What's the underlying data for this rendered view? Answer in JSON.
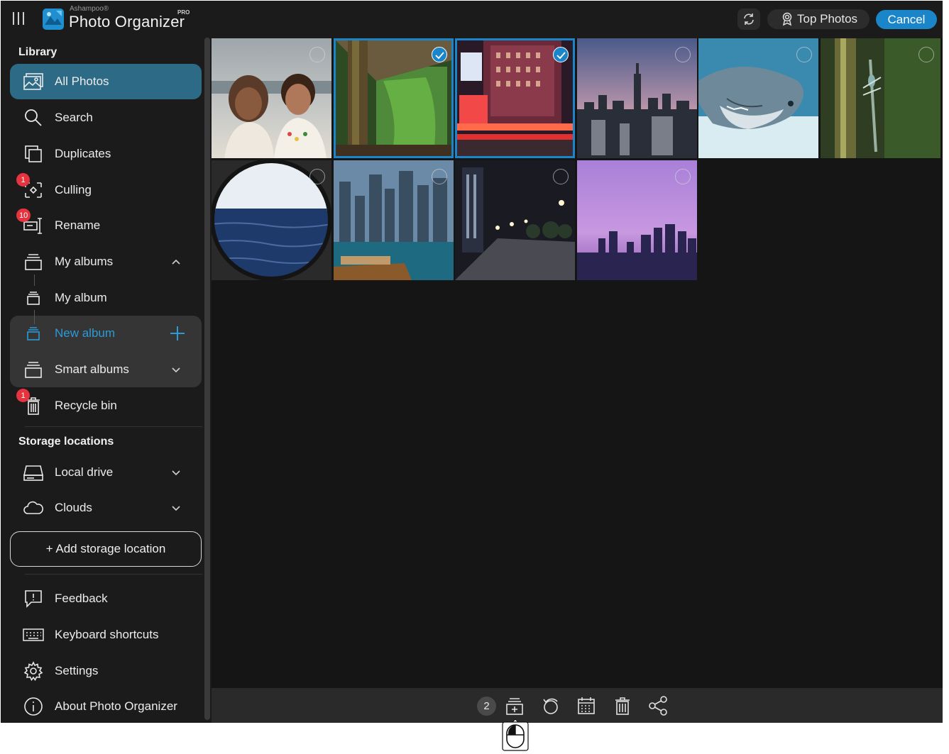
{
  "header": {
    "brand_small": "Ashampoo®",
    "brand_title": "Photo Organizer",
    "brand_badge": "PRO",
    "top_photos_label": "Top Photos",
    "cancel_label": "Cancel"
  },
  "sidebar": {
    "library_heading": "Library",
    "items": {
      "all_photos": "All Photos",
      "search": "Search",
      "duplicates": "Duplicates",
      "culling": "Culling",
      "rename": "Rename",
      "my_albums": "My albums",
      "my_album": "My album",
      "new_album": "New album",
      "smart_albums": "Smart albums",
      "recycle_bin": "Recycle bin",
      "local_drive": "Local drive",
      "clouds": "Clouds",
      "feedback": "Feedback",
      "keyboard_shortcuts": "Keyboard shortcuts",
      "settings": "Settings",
      "about": "About Photo Organizer"
    },
    "badges": {
      "culling": "1",
      "rename": "10",
      "recycle_bin": "1"
    },
    "storage_heading": "Storage locations",
    "add_storage_label": "+ Add storage location"
  },
  "grid": {
    "photos": [
      {
        "subject": "couple on beach",
        "selected": false
      },
      {
        "subject": "forest trees",
        "selected": true
      },
      {
        "subject": "times square night",
        "selected": true
      },
      {
        "subject": "city skyline dusk",
        "selected": false
      },
      {
        "subject": "dolphin",
        "selected": false
      },
      {
        "subject": "dragonfly on stem",
        "selected": false
      },
      {
        "subject": "ocean through porthole",
        "selected": false
      },
      {
        "subject": "dubai marina boat",
        "selected": false
      },
      {
        "subject": "promenade at night",
        "selected": false
      },
      {
        "subject": "purple skyline",
        "selected": false
      }
    ]
  },
  "toolbar": {
    "selected_count": "2"
  },
  "colors": {
    "accent": "#1a86c9",
    "active_item": "#2d6a86",
    "badge": "#e5333f",
    "background": "#1b1b1b"
  }
}
